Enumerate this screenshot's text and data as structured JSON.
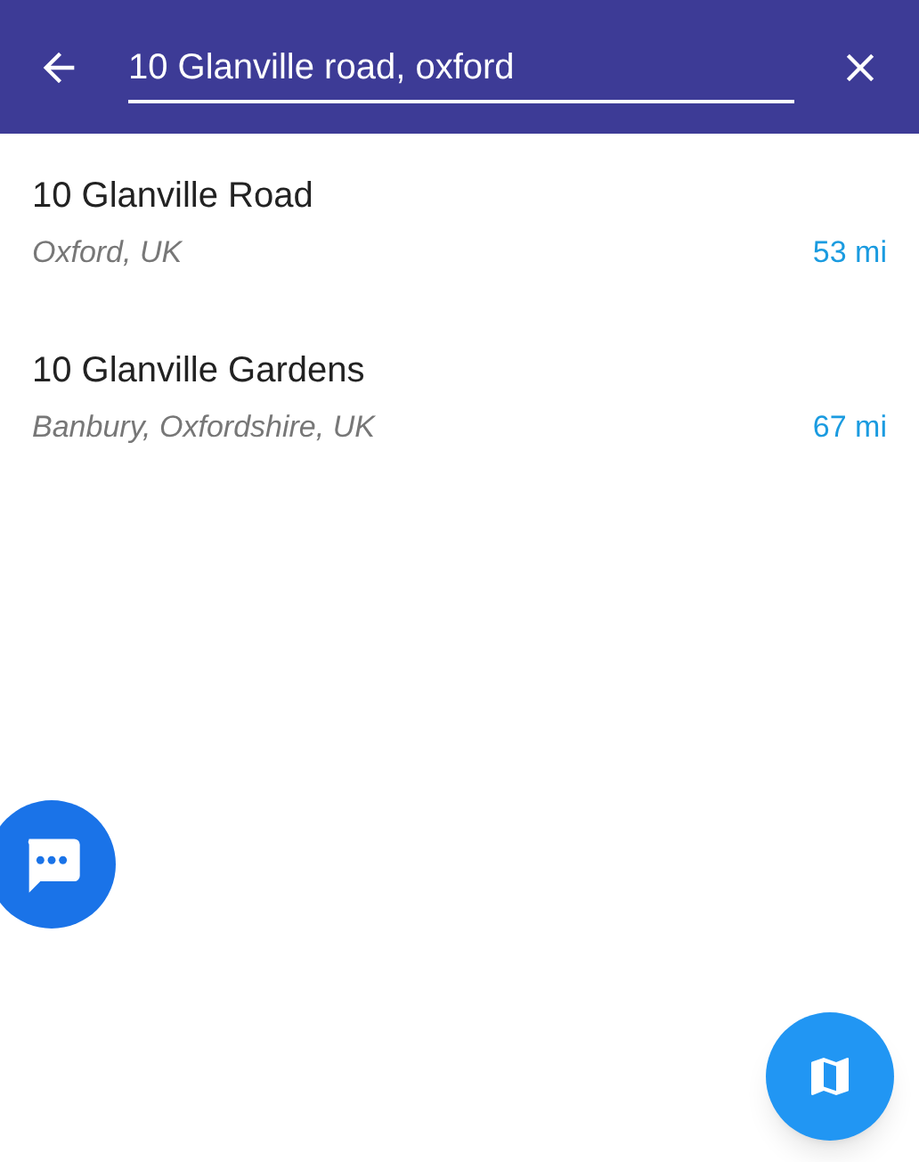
{
  "search": {
    "value": "10 Glanville road, oxford"
  },
  "results": [
    {
      "title": "10 Glanville Road",
      "subtitle": "Oxford, UK",
      "distance": "53 mi"
    },
    {
      "title": "10 Glanville Gardens",
      "subtitle": "Banbury, Oxfordshire, UK",
      "distance": "67 mi"
    }
  ]
}
